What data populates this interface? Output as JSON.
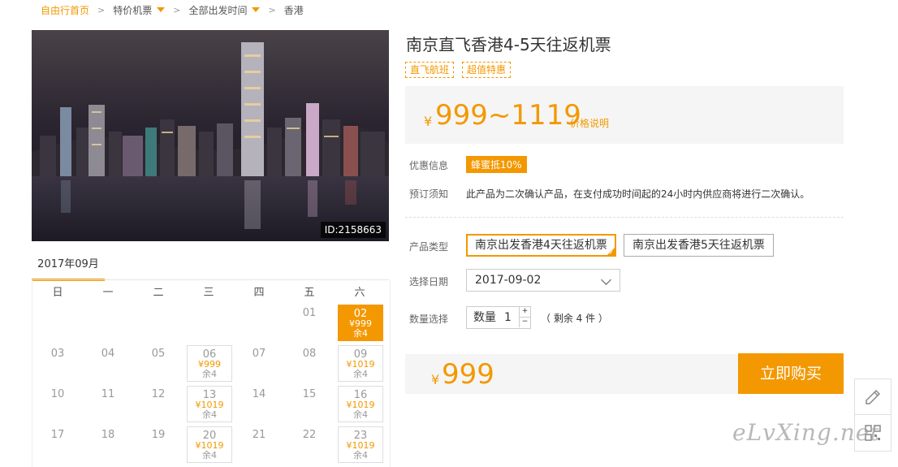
{
  "breadcrumb": {
    "home": "自由行首页",
    "category": "特价机票",
    "departure": "全部出发时间",
    "destination": "香港"
  },
  "photo": {
    "id_tag": "ID:2158663"
  },
  "calendar": {
    "month": "2017年09月",
    "weekdays": [
      "日",
      "一",
      "二",
      "三",
      "四",
      "五",
      "六"
    ],
    "rows": [
      [
        {
          "d": ""
        },
        {
          "d": ""
        },
        {
          "d": ""
        },
        {
          "d": ""
        },
        {
          "d": ""
        },
        {
          "d": "01"
        },
        {
          "d": "02",
          "p": "¥999",
          "r": "余4",
          "sel": true
        }
      ],
      [
        {
          "d": "03"
        },
        {
          "d": "04"
        },
        {
          "d": "05"
        },
        {
          "d": "06",
          "p": "¥999",
          "r": "余4"
        },
        {
          "d": "07"
        },
        {
          "d": "08"
        },
        {
          "d": "09",
          "p": "¥1019",
          "r": "余4"
        }
      ],
      [
        {
          "d": "10"
        },
        {
          "d": "11"
        },
        {
          "d": "12"
        },
        {
          "d": "13",
          "p": "¥1019",
          "r": "余4"
        },
        {
          "d": "14"
        },
        {
          "d": "15"
        },
        {
          "d": "16",
          "p": "¥1019",
          "r": "余4"
        }
      ],
      [
        {
          "d": "17"
        },
        {
          "d": "18"
        },
        {
          "d": "19"
        },
        {
          "d": "20",
          "p": "¥1019",
          "r": "余4"
        },
        {
          "d": "21"
        },
        {
          "d": "22"
        },
        {
          "d": "23",
          "p": "¥1019",
          "r": "余4"
        }
      ]
    ]
  },
  "product": {
    "title": "南京直飞香港4-5天往返机票",
    "tags": [
      "直飞航班",
      "超值特惠"
    ],
    "price_symbol": "¥",
    "price_range": "999~1119",
    "price_note": "价格说明",
    "promo_label": "优惠信息",
    "promo_badge": "蜂蜜抵10%",
    "notice_label": "预订须知",
    "notice_text": "此产品为二次确认产品，在支付成功时间起的24小时内供应商将进行二次确认。",
    "type_label": "产品类型",
    "options": [
      "南京出发香港4天往返机票",
      "南京出发香港5天往返机票"
    ],
    "selected_option": 0,
    "date_label": "选择日期",
    "date_value": "2017-09-02",
    "qty_label": "数量选择",
    "qty_prefix": "数量",
    "qty_value": "1",
    "qty_plus": "+",
    "qty_minus": "−",
    "remain_text": "（ 剩余 4 件 ）",
    "total_symbol": "¥",
    "total": "999",
    "buy_label": "立即购买"
  },
  "watermark": "eLvXing.net",
  "colors": {
    "accent": "#f39800",
    "panel": "#f5f5f5"
  },
  "icons": [
    "chevron-right-icon",
    "dropdown-triangle-icon",
    "chevron-down-icon",
    "pencil-icon",
    "qr-code-icon",
    "check-icon"
  ]
}
